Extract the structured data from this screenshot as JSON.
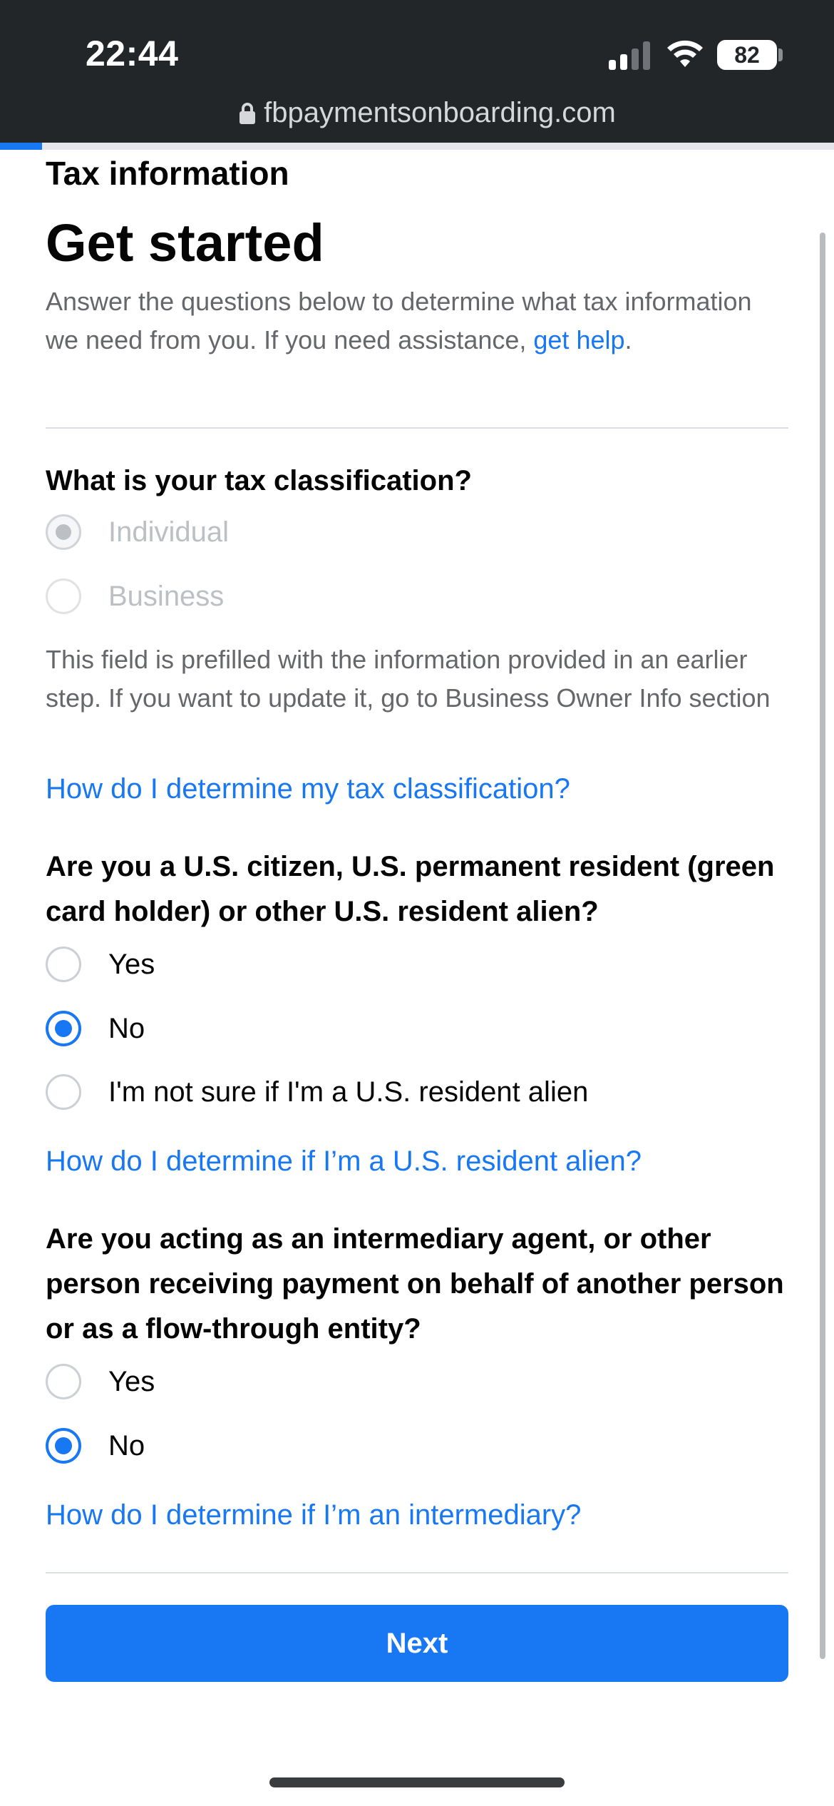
{
  "status_bar": {
    "time": "22:44",
    "battery": "82"
  },
  "browser": {
    "url": "fbpaymentsonboarding.com",
    "progress_fraction": 0.05
  },
  "page": {
    "section_title": "Tax information",
    "heading": "Get started",
    "intro": "Answer the questions below to determine what tax information we need from you. If you need assistance, ",
    "intro_link": "get help",
    "intro_end": "."
  },
  "q1": {
    "question": "What is your tax classification?",
    "options": [
      "Individual",
      "Business"
    ],
    "selected": "Individual",
    "disabled": true,
    "note": "This field is prefilled with the information provided in an earlier step. If you want to update it, go to Business Owner Info section",
    "help_link": "How do I determine my tax classification?"
  },
  "q2": {
    "question": "Are you a U.S. citizen, U.S. permanent resident (green card holder) or other U.S. resident alien?",
    "options": [
      "Yes",
      "No",
      "I'm not sure if I'm a U.S. resident alien"
    ],
    "selected": "No",
    "help_link": "How do I determine if I’m a U.S. resident alien?"
  },
  "q3": {
    "question": "Are you acting as an intermediary agent, or other person receiving payment on behalf of another person or as a flow-through entity?",
    "options": [
      "Yes",
      "No"
    ],
    "selected": "No",
    "help_link": "How do I determine if I’m an intermediary?"
  },
  "actions": {
    "next_label": "Next"
  },
  "colors": {
    "accent": "#1877f2",
    "chrome": "#232629"
  },
  "icons": {
    "lock": "lock-icon",
    "wifi": "wifi-icon",
    "signal": "signal-icon",
    "battery": "battery-icon"
  }
}
